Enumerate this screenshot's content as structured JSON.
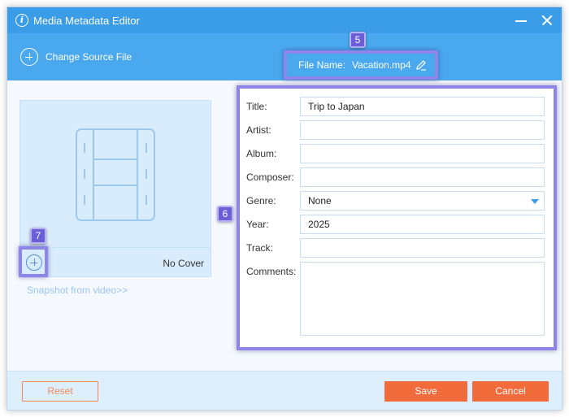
{
  "window": {
    "title": "Media Metadata Editor",
    "icon": "info-icon"
  },
  "toolbar": {
    "change_source_label": "Change Source File",
    "file_name_label": "File Name:",
    "file_name_value": "Vacation.mp4",
    "badge": "5"
  },
  "cover": {
    "badge": "7",
    "status": "No Cover",
    "snapshot_link": "Snapshot from video>>",
    "placeholder_icon": "film-strip-icon"
  },
  "form": {
    "badge": "6",
    "fields": {
      "title": {
        "label": "Title:",
        "value": "Trip to Japan"
      },
      "artist": {
        "label": "Artist:",
        "value": ""
      },
      "album": {
        "label": "Album:",
        "value": ""
      },
      "composer": {
        "label": "Composer:",
        "value": ""
      },
      "genre": {
        "label": "Genre:",
        "value": "None"
      },
      "year": {
        "label": "Year:",
        "value": "2025"
      },
      "track": {
        "label": "Track:",
        "value": ""
      },
      "comments": {
        "label": "Comments:",
        "value": ""
      }
    }
  },
  "footer": {
    "reset_label": "Reset",
    "save_label": "Save",
    "cancel_label": "Cancel"
  },
  "colors": {
    "titlebar": "#3b9ce8",
    "toolbar": "#4aa8ee",
    "accent_button": "#f26b3a",
    "highlight": "#8e85e8",
    "badge": "#6a5fd8"
  }
}
